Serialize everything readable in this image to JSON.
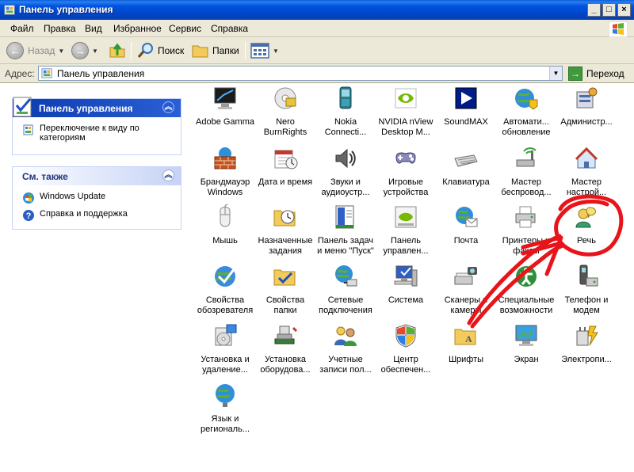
{
  "window": {
    "title": "Панель управления",
    "controls": [
      "_",
      "□",
      "×"
    ]
  },
  "menu": [
    "Файл",
    "Правка",
    "Вид",
    "Избранное",
    "Сервис",
    "Справка"
  ],
  "toolbar": {
    "back_label": "Назад",
    "search_label": "Поиск",
    "folders_label": "Папки"
  },
  "address": {
    "label": "Адрес:",
    "value": "Панель управления",
    "go_label": "Переход"
  },
  "left_panel": {
    "task_box": {
      "title": "Панель управления",
      "links": [
        "Переключение к виду по категориям"
      ]
    },
    "see_also": {
      "title": "См. также",
      "links": [
        "Windows Update",
        "Справка и поддержка"
      ]
    }
  },
  "items": [
    {
      "label": "Adobe Gamma",
      "icon": "monitor-icon"
    },
    {
      "label": "Nero\nBurnRights",
      "icon": "nero-icon"
    },
    {
      "label": "Nokia\nConnecti...",
      "icon": "phone-icon"
    },
    {
      "label": "NVIDIA nView\nDesktop M...",
      "icon": "nvidia-icon"
    },
    {
      "label": "SoundMAX",
      "icon": "soundmax-icon"
    },
    {
      "label": "Автомати...\nобновление",
      "icon": "globe-shield-icon"
    },
    {
      "label": "Администр...",
      "icon": "admin-tools-icon"
    },
    {
      "label": "Брандмауэр\nWindows",
      "icon": "firewall-icon"
    },
    {
      "label": "Дата и время",
      "icon": "calendar-icon"
    },
    {
      "label": "Звуки и\nаудиоустр...",
      "icon": "speaker-icon"
    },
    {
      "label": "Игровые\nустройства",
      "icon": "gamepad-icon"
    },
    {
      "label": "Клавиатура",
      "icon": "keyboard-icon"
    },
    {
      "label": "Мастер\nбеспровод...",
      "icon": "wireless-icon"
    },
    {
      "label": "Мастер\nнастрой...",
      "icon": "network-wizard-icon"
    },
    {
      "label": "Мышь",
      "icon": "mouse-icon"
    },
    {
      "label": "Назначенные\nзадания",
      "icon": "scheduled-tasks-icon"
    },
    {
      "label": "Панель задач\nи меню \"Пуск\"",
      "icon": "taskbar-icon"
    },
    {
      "label": "Панель\nуправлен...",
      "icon": "nvidia-panel-icon"
    },
    {
      "label": "Почта",
      "icon": "mail-icon"
    },
    {
      "label": "Принтеры и\nфаксы",
      "icon": "printer-icon"
    },
    {
      "label": "Речь",
      "icon": "speech-icon"
    },
    {
      "label": "Свойства\nобозревателя",
      "icon": "internet-options-icon"
    },
    {
      "label": "Свойства\nпапки",
      "icon": "folder-options-icon"
    },
    {
      "label": "Сетевые\nподключения",
      "icon": "network-icon"
    },
    {
      "label": "Система",
      "icon": "system-icon"
    },
    {
      "label": "Сканеры и\nкамеры",
      "icon": "scanner-icon"
    },
    {
      "label": "Специальные\nвозможности",
      "icon": "accessibility-icon"
    },
    {
      "label": "Телефон и\nмодем",
      "icon": "phone-modem-icon"
    },
    {
      "label": "Установка и\nудаление...",
      "icon": "add-remove-icon"
    },
    {
      "label": "Установка\nоборудова...",
      "icon": "hardware-icon"
    },
    {
      "label": "Учетные\nзаписи пол...",
      "icon": "users-icon"
    },
    {
      "label": "Центр\nобеспечен...",
      "icon": "security-center-icon"
    },
    {
      "label": "Шрифты",
      "icon": "fonts-folder-icon"
    },
    {
      "label": "Экран",
      "icon": "display-icon"
    },
    {
      "label": "Электропи...",
      "icon": "power-icon"
    },
    {
      "label": "Язык и\nрегиональ...",
      "icon": "regional-icon"
    }
  ],
  "annotation_color": "#e8141a"
}
